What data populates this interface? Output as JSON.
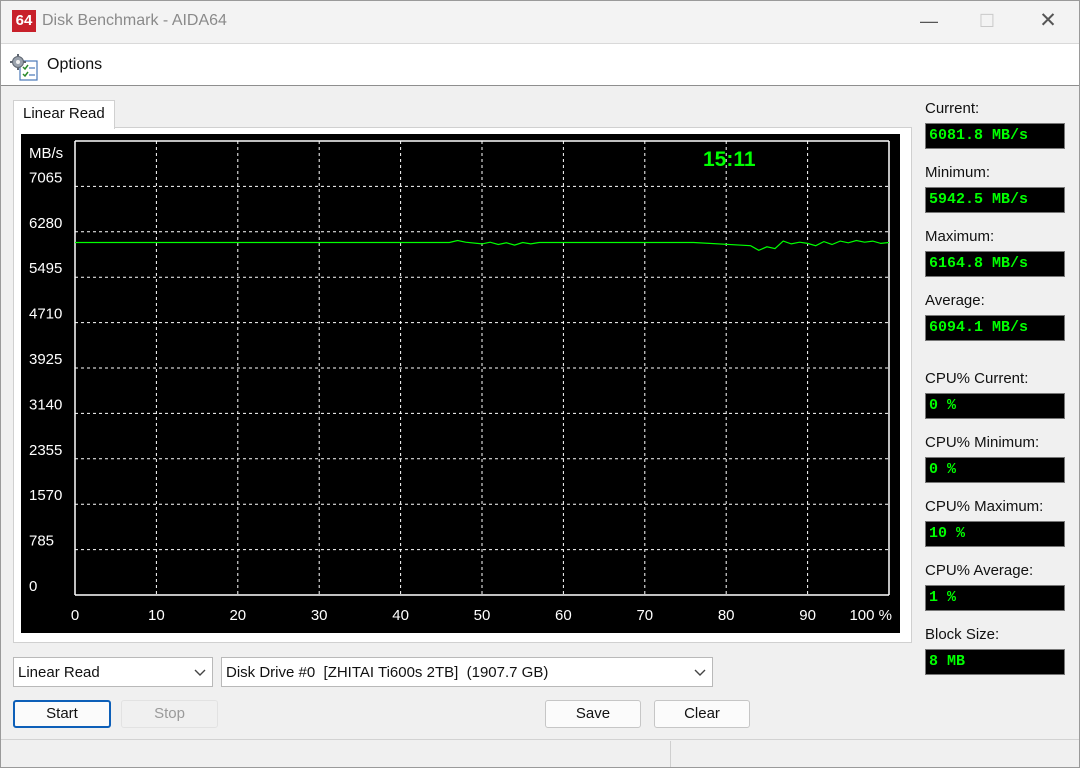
{
  "window": {
    "icon_text": "64",
    "title": "Disk Benchmark - AIDA64",
    "controls": {
      "minimize": "—",
      "maximize": "☐",
      "close": "✕"
    }
  },
  "menu": {
    "options_label": "Options"
  },
  "tab": {
    "label": "Linear Read"
  },
  "chart_data": {
    "type": "line",
    "ylabel": "MB/s",
    "time": "15:11",
    "y_ticks": [
      "7065",
      "6280",
      "5495",
      "4710",
      "3925",
      "3140",
      "2355",
      "1570",
      "785",
      "0"
    ],
    "x_ticks": [
      "0",
      "10",
      "20",
      "30",
      "40",
      "50",
      "60",
      "70",
      "80",
      "90",
      "100 %"
    ],
    "ylim": [
      0,
      7850
    ],
    "xlim": [
      0,
      100
    ],
    "grid": true,
    "line_color": "#00ff00",
    "series": [
      {
        "x": [
          0,
          10,
          20,
          30,
          40,
          46,
          47,
          48,
          50,
          51,
          52,
          53,
          54,
          55,
          56,
          57,
          60,
          70,
          76,
          83,
          84,
          85,
          86,
          87,
          88,
          89,
          90,
          91,
          92,
          93,
          94,
          95,
          96,
          97,
          98,
          99,
          100
        ],
        "values": [
          6095,
          6095,
          6095,
          6095,
          6095,
          6095,
          6130,
          6100,
          6070,
          6100,
          6060,
          6090,
          6050,
          6095,
          6070,
          6095,
          6095,
          6095,
          6095,
          6040,
          5960,
          6020,
          5990,
          6120,
          6070,
          6100,
          6080,
          6040,
          6110,
          6060,
          6120,
          6090,
          6130,
          6100,
          6120,
          6080,
          6095
        ]
      }
    ]
  },
  "stats": [
    {
      "label": "Current:",
      "value": "6081.8 MB/s"
    },
    {
      "label": "Minimum:",
      "value": "5942.5 MB/s"
    },
    {
      "label": "Maximum:",
      "value": "6164.8 MB/s"
    },
    {
      "label": "Average:",
      "value": "6094.1 MB/s"
    },
    {
      "label": "CPU% Current:",
      "value": "0 %"
    },
    {
      "label": "CPU% Minimum:",
      "value": "0 %"
    },
    {
      "label": "CPU% Maximum:",
      "value": "10 %"
    },
    {
      "label": "CPU% Average:",
      "value": "1 %"
    },
    {
      "label": "Block Size:",
      "value": "8 MB"
    }
  ],
  "controls": {
    "test_select": "Linear Read",
    "drive_select": "Disk Drive #0  [ZHITAI Ti600s 2TB]  (1907.7 GB)",
    "start": "Start",
    "stop": "Stop",
    "save": "Save",
    "clear": "Clear"
  },
  "colors": {
    "accent_green": "#00ff00",
    "focus_blue": "#0d5fb8",
    "icon_red": "#c8202a"
  }
}
